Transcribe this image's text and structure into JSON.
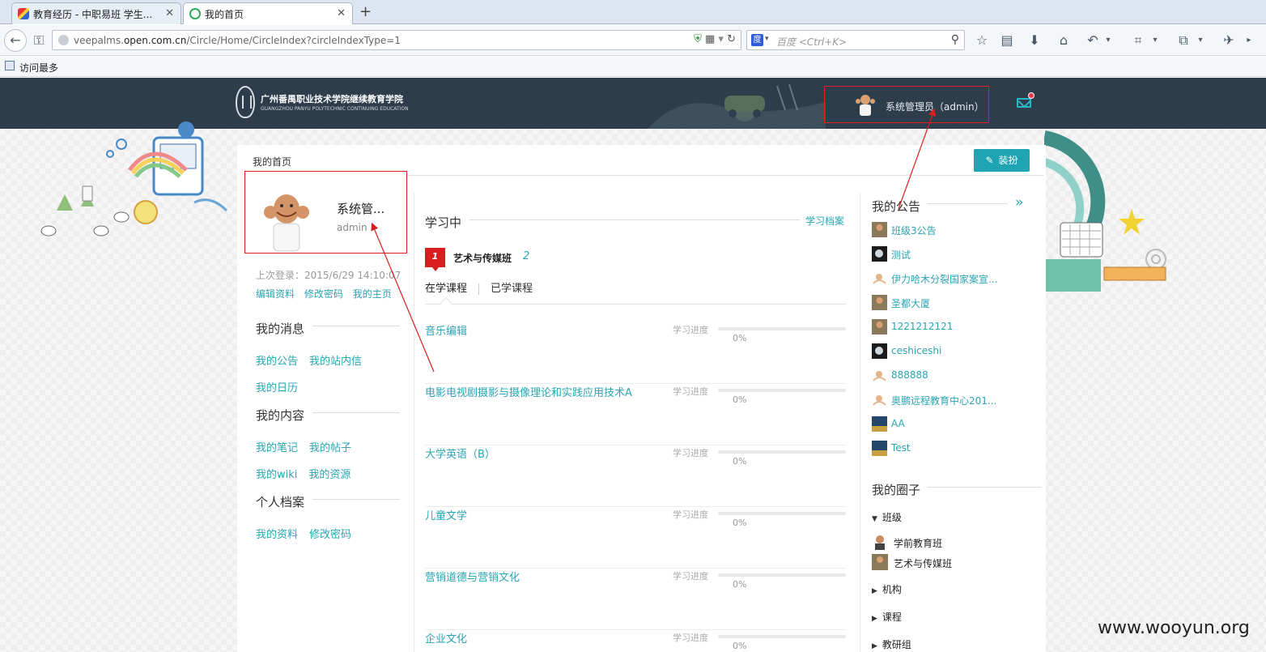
{
  "browser": {
    "tabs": [
      {
        "title": "教育经历 - 中职易班 学生...",
        "active": false
      },
      {
        "title": "我的首页",
        "active": true
      }
    ],
    "url_prefix": "veepalms.",
    "url_domain": "open.com.cn",
    "url_path": "/Circle/Home/CircleIndex?circleIndexType=1",
    "search_placeholder": "百度 <Ctrl+K>",
    "bookmark_label": "访问最多"
  },
  "site": {
    "logo_cn": "广州番禺职业技术学院继续教育学院",
    "logo_en": "GUANGZHOU PANYU POLYTECHNIC CONTINUING EDUCATION",
    "header_user": "系统管理员（admin）",
    "breadcrumb": "我的首页",
    "dress_button": "装扮"
  },
  "profile": {
    "name": "系统管...",
    "id": "admin",
    "last_login": "上次登录：2015/6/29 14:10:07",
    "links": [
      "编辑资料",
      "修改密码",
      "我的主页"
    ]
  },
  "left_menu": {
    "messages_title": "我的消息",
    "messages_row1": [
      "我的公告",
      "我的站内信"
    ],
    "messages_row2": [
      "我的日历"
    ],
    "content_title": "我的内容",
    "content_row1": [
      "我的笔记",
      "我的帖子"
    ],
    "content_row2": [
      "我的wiki",
      "我的资源"
    ],
    "profile_title": "个人档案",
    "profile_row1": [
      "我的资料",
      "修改密码"
    ]
  },
  "learning": {
    "title": "学习中",
    "archive_link": "学习档案",
    "class_rank": "1",
    "class_name": "艺术与传媒班",
    "class_count": "2",
    "tab_current": "在学课程",
    "tab_done": "已学课程",
    "progress_label": "学习进度",
    "courses": [
      {
        "name": "音乐编辑",
        "progress": "0%"
      },
      {
        "name": "电影电视剧摄影与摄像理论和实践应用技术A",
        "progress": "0%"
      },
      {
        "name": "大学英语（B）",
        "progress": "0%"
      },
      {
        "name": "儿童文学",
        "progress": "0%"
      },
      {
        "name": "营销道德与营销文化",
        "progress": "0%"
      },
      {
        "name": "企业文化",
        "progress": "0%"
      }
    ]
  },
  "notices": {
    "title": "我的公告",
    "more_icon": "double-chevron-right",
    "items": [
      "班级3公告",
      "测试",
      "伊力哈木分裂国家案宣...",
      "圣都大厦",
      "1221212121",
      "ceshiceshi",
      "888888",
      "奥鹏远程教育中心201...",
      "AA",
      "Test"
    ]
  },
  "circles": {
    "title": "我的圈子",
    "groups": [
      "班级",
      "机构",
      "课程",
      "教研组"
    ],
    "class_items": [
      "学前教育班",
      "艺术与传媒班"
    ]
  },
  "watermark": "www.wooyun.org",
  "colors": {
    "accent": "#2aa5b3",
    "header_bg": "#2e3d4b",
    "highlight_red": "#e02020",
    "badge_red": "#d81e1e"
  }
}
